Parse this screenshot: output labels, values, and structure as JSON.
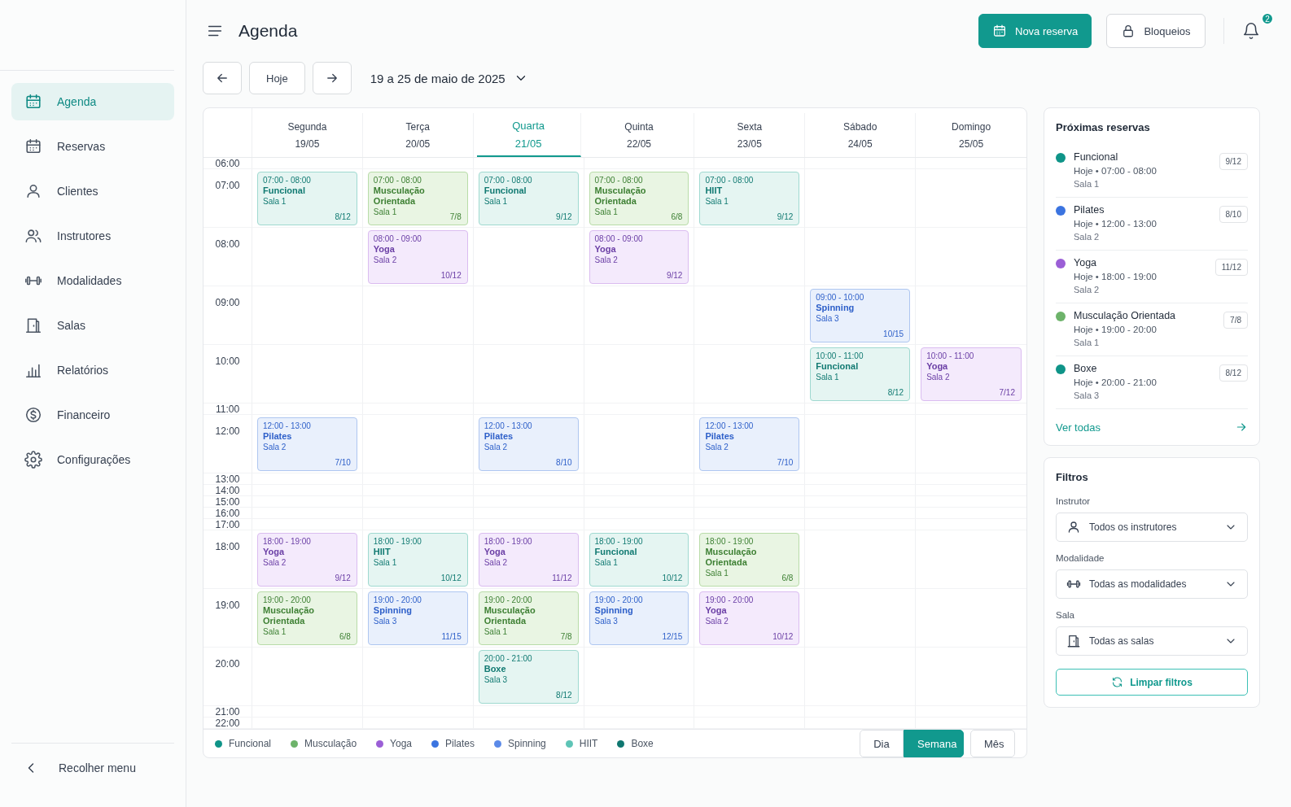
{
  "sidebar": {
    "items": [
      {
        "label": "Agenda",
        "selected": true
      },
      {
        "label": "Reservas",
        "selected": false
      },
      {
        "label": "Clientes",
        "selected": false
      },
      {
        "label": "Instrutores",
        "selected": false
      },
      {
        "label": "Modalidades",
        "selected": false
      },
      {
        "label": "Salas",
        "selected": false
      },
      {
        "label": "Relatórios",
        "selected": false
      },
      {
        "label": "Financeiro",
        "selected": false
      },
      {
        "label": "Configurações",
        "selected": false
      }
    ],
    "collapse": "Recolher menu"
  },
  "header": {
    "title": "Agenda",
    "primary_button": "Nova reserva",
    "secondary_button": "Bloqueios",
    "notifications": "2"
  },
  "toolbar": {
    "today": "Hoje",
    "range": "19 a 25 de maio de 2025"
  },
  "calendar": {
    "days": [
      {
        "name": "Segunda",
        "date": "19/05",
        "selected": false
      },
      {
        "name": "Terça",
        "date": "20/05",
        "selected": false
      },
      {
        "name": "Quarta",
        "date": "21/05",
        "selected": true
      },
      {
        "name": "Quinta",
        "date": "22/05",
        "selected": false
      },
      {
        "name": "Sexta",
        "date": "23/05",
        "selected": false
      },
      {
        "name": "Sábado",
        "date": "24/05",
        "selected": false
      },
      {
        "name": "Domingo",
        "date": "25/05",
        "selected": false
      }
    ],
    "rows": [
      {
        "time": "06:00"
      },
      {
        "time": "07:00",
        "cells": [
          {
            "kind": "funcional",
            "time": "07:00 - 08:00",
            "title": "Funcional",
            "room": "Sala 1",
            "count": "8/12"
          },
          {
            "kind": "musculacao",
            "time": "07:00 - 08:00",
            "title": "Musculação Orientada",
            "room": "Sala 1",
            "count": "7/8"
          },
          {
            "kind": "funcional",
            "time": "07:00 - 08:00",
            "title": "Funcional",
            "room": "Sala 1",
            "count": "9/12"
          },
          {
            "kind": "musculacao",
            "time": "07:00 - 08:00",
            "title": "Musculação Orientada",
            "room": "Sala 1",
            "count": "6/8"
          },
          {
            "kind": "hiit",
            "time": "07:00 - 08:00",
            "title": "HIIT",
            "room": "Sala 1",
            "count": "9/12"
          },
          null,
          null
        ]
      },
      {
        "time": "08:00",
        "cells": [
          null,
          {
            "kind": "yoga",
            "time": "08:00 - 09:00",
            "title": "Yoga",
            "room": "Sala 2",
            "count": "10/12"
          },
          null,
          {
            "kind": "yoga",
            "time": "08:00 - 09:00",
            "title": "Yoga",
            "room": "Sala 2",
            "count": "9/12"
          },
          null,
          null,
          null
        ]
      },
      {
        "time": "09:00",
        "cells": [
          null,
          null,
          null,
          null,
          null,
          {
            "kind": "spinning",
            "time": "09:00 - 10:00",
            "title": "Spinning",
            "room": "Sala 3",
            "count": "10/15"
          },
          null
        ]
      },
      {
        "time": "10:00",
        "cells": [
          null,
          null,
          null,
          null,
          null,
          {
            "kind": "funcional",
            "time": "10:00 - 11:00",
            "title": "Funcional",
            "room": "Sala 1",
            "count": "8/12"
          },
          {
            "kind": "yoga",
            "time": "10:00 - 11:00",
            "title": "Yoga",
            "room": "Sala 2",
            "count": "7/12"
          }
        ]
      },
      {
        "time": "11:00"
      },
      {
        "time": "12:00",
        "cells": [
          {
            "kind": "pilates",
            "time": "12:00 - 13:00",
            "title": "Pilates",
            "room": "Sala 2",
            "count": "7/10"
          },
          null,
          {
            "kind": "pilates",
            "time": "12:00 - 13:00",
            "title": "Pilates",
            "room": "Sala 2",
            "count": "8/10"
          },
          null,
          {
            "kind": "pilates",
            "time": "12:00 - 13:00",
            "title": "Pilates",
            "room": "Sala 2",
            "count": "7/10"
          },
          null,
          null
        ]
      },
      {
        "time": "13:00"
      },
      {
        "time": "14:00"
      },
      {
        "time": "15:00"
      },
      {
        "time": "16:00"
      },
      {
        "time": "17:00"
      },
      {
        "time": "18:00",
        "cells": [
          {
            "kind": "yoga",
            "time": "18:00 - 19:00",
            "title": "Yoga",
            "room": "Sala 2",
            "count": "9/12"
          },
          {
            "kind": "hiit",
            "time": "18:00 - 19:00",
            "title": "HIIT",
            "room": "Sala 1",
            "count": "10/12"
          },
          {
            "kind": "yoga",
            "time": "18:00 - 19:00",
            "title": "Yoga",
            "room": "Sala 2",
            "count": "11/12"
          },
          {
            "kind": "funcional",
            "time": "18:00 - 19:00",
            "title": "Funcional",
            "room": "Sala 1",
            "count": "10/12"
          },
          {
            "kind": "musculacao",
            "time": "18:00 - 19:00",
            "title": "Musculação Orientada",
            "room": "Sala 1",
            "count": "6/8"
          },
          null,
          null
        ]
      },
      {
        "time": "19:00",
        "cells": [
          {
            "kind": "musculacao",
            "time": "19:00 - 20:00",
            "title": "Musculação Orientada",
            "room": "Sala 1",
            "count": "6/8"
          },
          {
            "kind": "spinning",
            "time": "19:00 - 20:00",
            "title": "Spinning",
            "room": "Sala 3",
            "count": "11/15"
          },
          {
            "kind": "musculacao",
            "time": "19:00 - 20:00",
            "title": "Musculação Orientada",
            "room": "Sala 1",
            "count": "7/8"
          },
          {
            "kind": "spinning",
            "time": "19:00 - 20:00",
            "title": "Spinning",
            "room": "Sala 3",
            "count": "12/15"
          },
          {
            "kind": "yoga",
            "time": "19:00 - 20:00",
            "title": "Yoga",
            "room": "Sala 2",
            "count": "10/12"
          },
          null,
          null
        ]
      },
      {
        "time": "20:00",
        "cells": [
          null,
          null,
          {
            "kind": "boxe",
            "time": "20:00 - 21:00",
            "title": "Boxe",
            "room": "Sala 3",
            "count": "8/12"
          },
          null,
          null,
          null,
          null
        ]
      },
      {
        "time": "21:00"
      },
      {
        "time": "22:00"
      }
    ],
    "legend": [
      {
        "label": "Funcional",
        "color": "#0f9488"
      },
      {
        "label": "Musculação",
        "color": "#6db36a"
      },
      {
        "label": "Yoga",
        "color": "#9b5fd6"
      },
      {
        "label": "Pilates",
        "color": "#3b74e0"
      },
      {
        "label": "Spinning",
        "color": "#5b8ae8"
      },
      {
        "label": "HIIT",
        "color": "#5ec4b6"
      },
      {
        "label": "Boxe",
        "color": "#0f7770"
      }
    ],
    "views": [
      {
        "label": "Dia",
        "selected": false
      },
      {
        "label": "Semana",
        "selected": true
      },
      {
        "label": "Mês",
        "selected": false
      }
    ]
  },
  "upcoming": {
    "title": "Próximas reservas",
    "items": [
      {
        "name": "Funcional",
        "when": "Hoje • 07:00 - 08:00",
        "room": "Sala 1",
        "count": "9/12",
        "color": "#0f9488"
      },
      {
        "name": "Pilates",
        "when": "Hoje • 12:00 - 13:00",
        "room": "Sala 2",
        "count": "8/10",
        "color": "#3b74e0"
      },
      {
        "name": "Yoga",
        "when": "Hoje • 18:00 - 19:00",
        "room": "Sala 2",
        "count": "11/12",
        "color": "#9b5fd6"
      },
      {
        "name": "Musculação Orientada",
        "when": "Hoje • 19:00 - 20:00",
        "room": "Sala 1",
        "count": "7/8",
        "color": "#6db36a"
      },
      {
        "name": "Boxe",
        "when": "Hoje • 20:00 - 21:00",
        "room": "Sala 3",
        "count": "8/12",
        "color": "#0f9488"
      }
    ],
    "link": "Ver todas"
  },
  "filters": {
    "title": "Filtros",
    "fields": [
      {
        "label": "Instrutor",
        "value": "Todos os instrutores"
      },
      {
        "label": "Modalidade",
        "value": "Todas as modalidades"
      },
      {
        "label": "Sala",
        "value": "Todas as salas"
      }
    ],
    "clear_button": "Limpar filtros"
  }
}
